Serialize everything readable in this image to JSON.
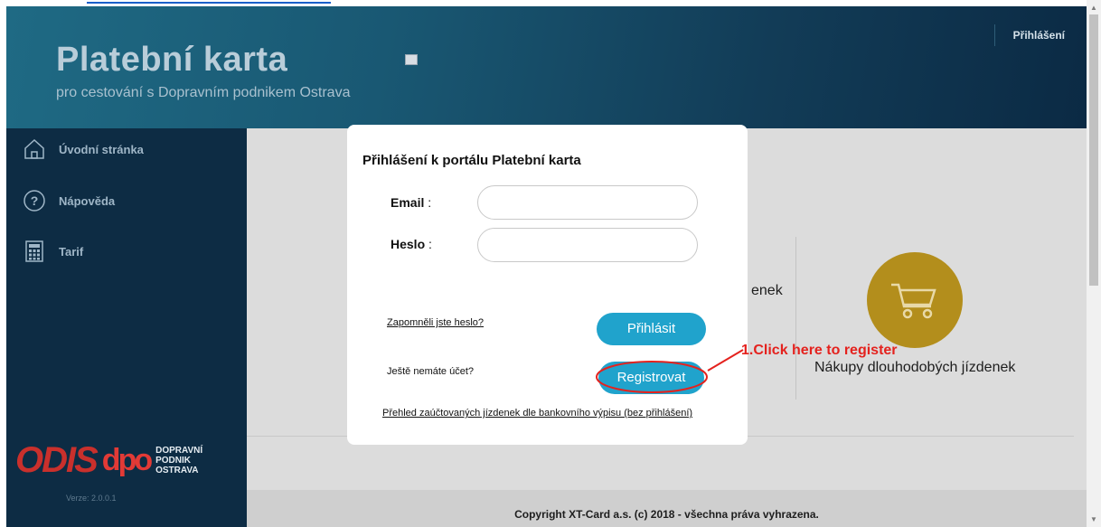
{
  "header": {
    "title": "Platební karta",
    "subtitle": "pro cestování s Dopravním podnikem Ostrava",
    "login_link": "Přihlášení"
  },
  "sidebar": {
    "items": [
      {
        "label": "Úvodní stránka",
        "icon": "home-icon"
      },
      {
        "label": "Nápověda",
        "icon": "help-icon"
      },
      {
        "label": "Tarif",
        "icon": "calculator-icon"
      }
    ],
    "logo": {
      "odis": "ODIS",
      "dpo_mark": "dpo",
      "dpo_text": [
        "DOPRAVNÍ",
        "PODNIK",
        "OSTRAVA"
      ]
    },
    "version": "Verze: 2.0.0.1"
  },
  "main": {
    "partial_text": "enek",
    "cart_label": "Nákupy dlouhodobých jízdenek",
    "copyright": "Copyright XT-Card a.s. (c) 2018 - všechna práva vyhrazena."
  },
  "modal": {
    "title": "Přihlášení k portálu Platební karta",
    "email_label": "Email",
    "email_value": "",
    "password_label": "Heslo",
    "password_value": "",
    "forgot_link": "Zapomněli jste heslo?",
    "login_button": "Přihlásit",
    "no_account_text": "Ještě nemáte účet?",
    "register_button": "Registrovat",
    "statement_link": "Přehled zaúčtovaných jízdenek dle bankovního výpisu (bez přihlášení)"
  },
  "annotation": {
    "text": "1.Click here to register",
    "color": "#e4221e"
  },
  "colors": {
    "accent": "#20a3cc",
    "sidebar_bg": "#0d2c44",
    "cart_circle": "#b38e1c"
  }
}
